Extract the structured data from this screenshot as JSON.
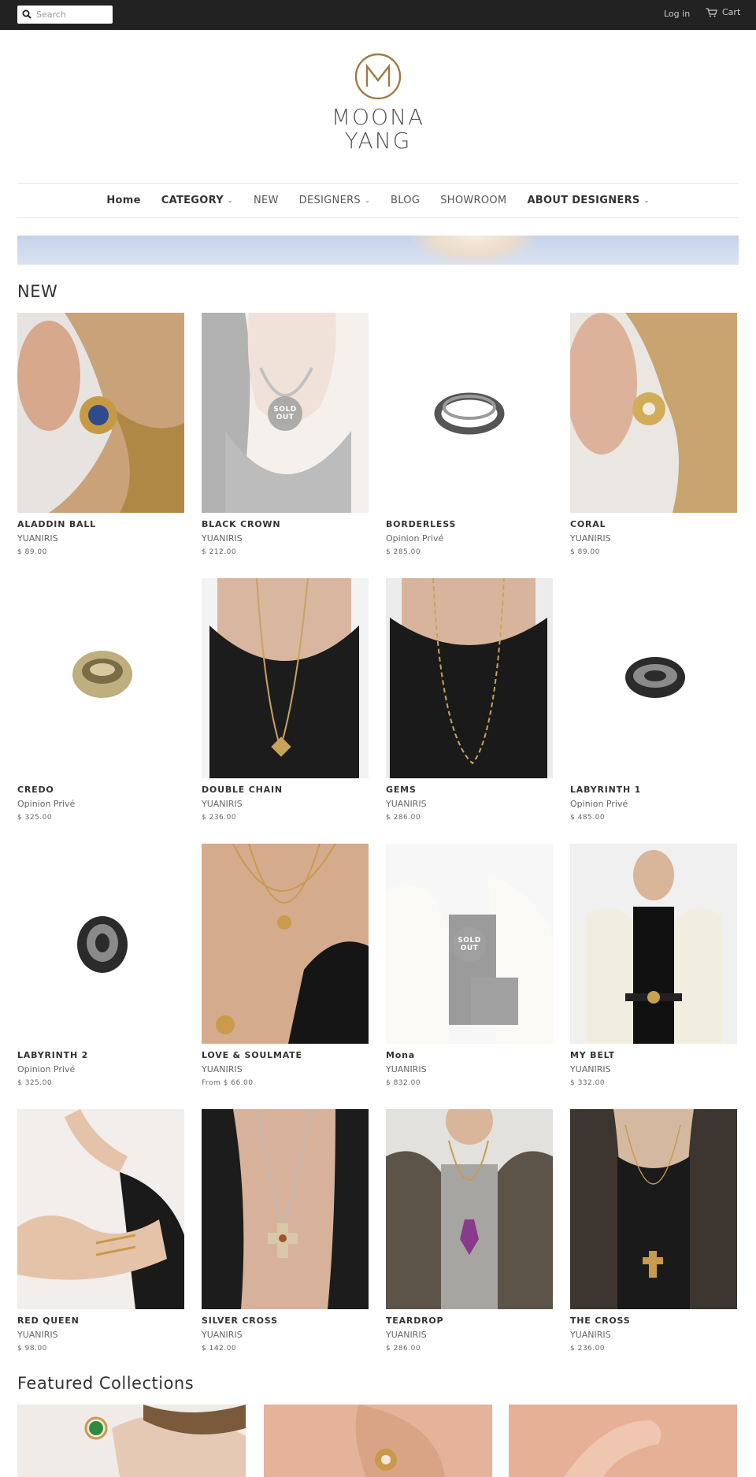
{
  "topbar": {
    "search_placeholder": "Search",
    "login": "Log in",
    "cart": "Cart"
  },
  "logo": {
    "line1": "MOONA",
    "line2": "YANG"
  },
  "nav": [
    {
      "label": "Home",
      "bold": true,
      "dropdown": false
    },
    {
      "label": "CATEGORY",
      "bold": true,
      "dropdown": true
    },
    {
      "label": "NEW",
      "bold": false,
      "dropdown": false
    },
    {
      "label": "DESIGNERS",
      "bold": false,
      "dropdown": true
    },
    {
      "label": "BLOG",
      "bold": false,
      "dropdown": false
    },
    {
      "label": "SHOWROOM",
      "bold": false,
      "dropdown": false
    },
    {
      "label": "ABOUT DESIGNERS",
      "bold": true,
      "dropdown": true
    }
  ],
  "sections": {
    "new_title": "NEW",
    "featured_title": "Featured Collections"
  },
  "sold_out_label": "SOLD OUT",
  "products": [
    {
      "name": "ALADDIN BALL",
      "vendor": "YUANIRIS",
      "price": "$ 89.00",
      "sold_out": false
    },
    {
      "name": "BLACK CROWN",
      "vendor": "YUANIRIS",
      "price": "$ 212.00",
      "sold_out": true
    },
    {
      "name": "BORDERLESS",
      "vendor": "Opinion Privé",
      "price": "$ 285.00",
      "sold_out": false
    },
    {
      "name": "CORAL",
      "vendor": "YUANIRIS",
      "price": "$ 89.00",
      "sold_out": false
    },
    {
      "name": "CREDO",
      "vendor": "Opinion Privé",
      "price": "$ 325.00",
      "sold_out": false
    },
    {
      "name": "DOUBLE CHAIN",
      "vendor": "YUANIRIS",
      "price": "$ 236.00",
      "sold_out": false
    },
    {
      "name": "GEMS",
      "vendor": "YUANIRIS",
      "price": "$ 286.00",
      "sold_out": false
    },
    {
      "name": "LABYRINTH 1",
      "vendor": "Opinion Privé",
      "price": "$ 485.00",
      "sold_out": false
    },
    {
      "name": "LABYRINTH 2",
      "vendor": "Opinion Privé",
      "price": "$ 325.00",
      "sold_out": false
    },
    {
      "name": "LOVE & SOULMATE",
      "vendor": "YUANIRIS",
      "price": "From $ 66.00",
      "sold_out": false
    },
    {
      "name": "Mona",
      "vendor": "YUANIRIS",
      "price": "$ 832.00",
      "sold_out": true
    },
    {
      "name": "MY BELT",
      "vendor": "YUANIRIS",
      "price": "$ 332.00",
      "sold_out": false
    },
    {
      "name": "RED QUEEN",
      "vendor": "YUANIRIS",
      "price": "$ 98.00",
      "sold_out": false
    },
    {
      "name": "SILVER CROSS",
      "vendor": "YUANIRIS",
      "price": "$ 142.00",
      "sold_out": false
    },
    {
      "name": "TEARDROP",
      "vendor": "YUANIRIS",
      "price": "$ 286.00",
      "sold_out": false
    },
    {
      "name": "THE CROSS",
      "vendor": "YUANIRIS",
      "price": "$ 236.00",
      "sold_out": false
    }
  ],
  "colors": {
    "topbar": "#222222",
    "logo_gold": "#a07a45",
    "text": "#333333"
  }
}
